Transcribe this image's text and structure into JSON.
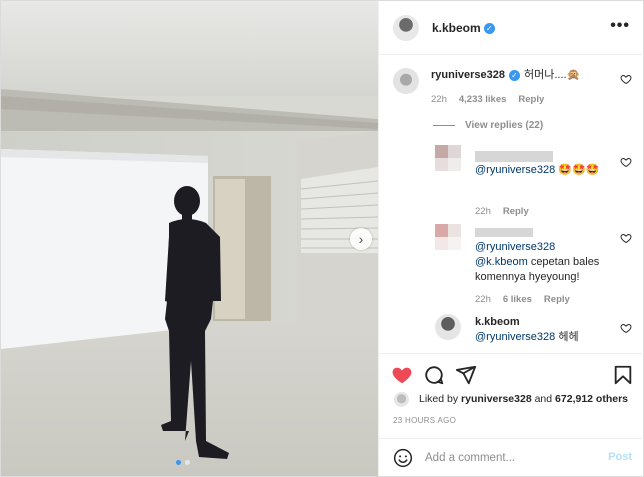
{
  "post": {
    "author": "k.kbeom",
    "more_glyph": "•••"
  },
  "carousel": {
    "slide_count": 2,
    "active_index": 0,
    "next_glyph": "›"
  },
  "comments": [
    {
      "username": "ryuniverse328",
      "text": "허머나....🙊",
      "time": "22h",
      "likes": "4,233 likes",
      "reply": "Reply",
      "view_replies": "View replies (22)"
    },
    {
      "mention": "@ryuniverse328",
      "text": "🤩🤩🤩",
      "time": "22h",
      "reply": "Reply"
    },
    {
      "mention_1": "@ryuniverse328",
      "mention_2": "@k.kbeom",
      "text": "cepetan bales komennya hyeyoung!",
      "time": "22h",
      "likes": "6 likes",
      "reply": "Reply"
    },
    {
      "username": "k.kbeom",
      "mention": "@ryuniverse328",
      "text": "헤헤"
    }
  ],
  "actions": {
    "liked_by_prefix": "Liked by",
    "liked_by_user": "ryuniverse328",
    "liked_by_and": "and",
    "liked_by_count": "672,912 others",
    "timestamp": "23 HOURS AGO"
  },
  "add_comment": {
    "placeholder": "Add a comment...",
    "post_label": "Post"
  },
  "icons": {
    "verified": "verified-icon",
    "like_filled": "heart-filled-icon",
    "comment": "comment-icon",
    "share": "share-icon",
    "save": "bookmark-icon",
    "emoji": "emoji-icon"
  },
  "colors": {
    "like_red": "#ed4956",
    "verified_blue": "#3897f0",
    "mention_blue": "#00376b",
    "post_disabled": "#b2dffc"
  }
}
